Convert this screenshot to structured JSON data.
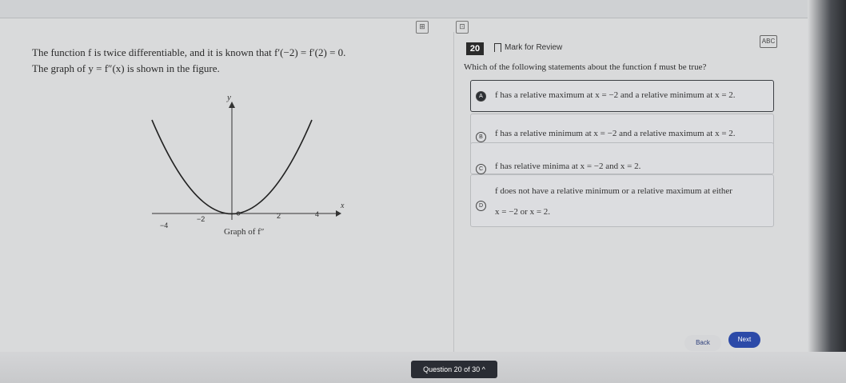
{
  "question": {
    "line1": "The function f is twice differentiable, and it is known that f′(−2) = f′(2) = 0.",
    "line2": "The graph of y = f″(x) is shown in the figure.",
    "graph_caption": "Graph of f″",
    "axis_y": "y",
    "axis_x": "x",
    "ticks": [
      "−4",
      "−2",
      "2",
      "4"
    ]
  },
  "header": {
    "number": "20",
    "mark_label": "Mark for Review",
    "abc_label": "ABC"
  },
  "prompt": "Which of the following statements about the function f must be true?",
  "choices": [
    {
      "letter": "A",
      "text": "f has a relative maximum at x = −2 and a relative minimum at x = 2."
    },
    {
      "letter": "B",
      "text": "f has a relative minimum at x = −2 and a relative maximum at x = 2."
    },
    {
      "letter": "C",
      "text": "f has relative minima at x = −2 and x = 2."
    },
    {
      "letter": "D",
      "text": "f does not have a relative minimum or a relative maximum at either",
      "text2": "x = −2 or x = 2."
    }
  ],
  "nav": {
    "back": "Back",
    "next": "Next",
    "question_counter": "Question 20 of 30"
  }
}
